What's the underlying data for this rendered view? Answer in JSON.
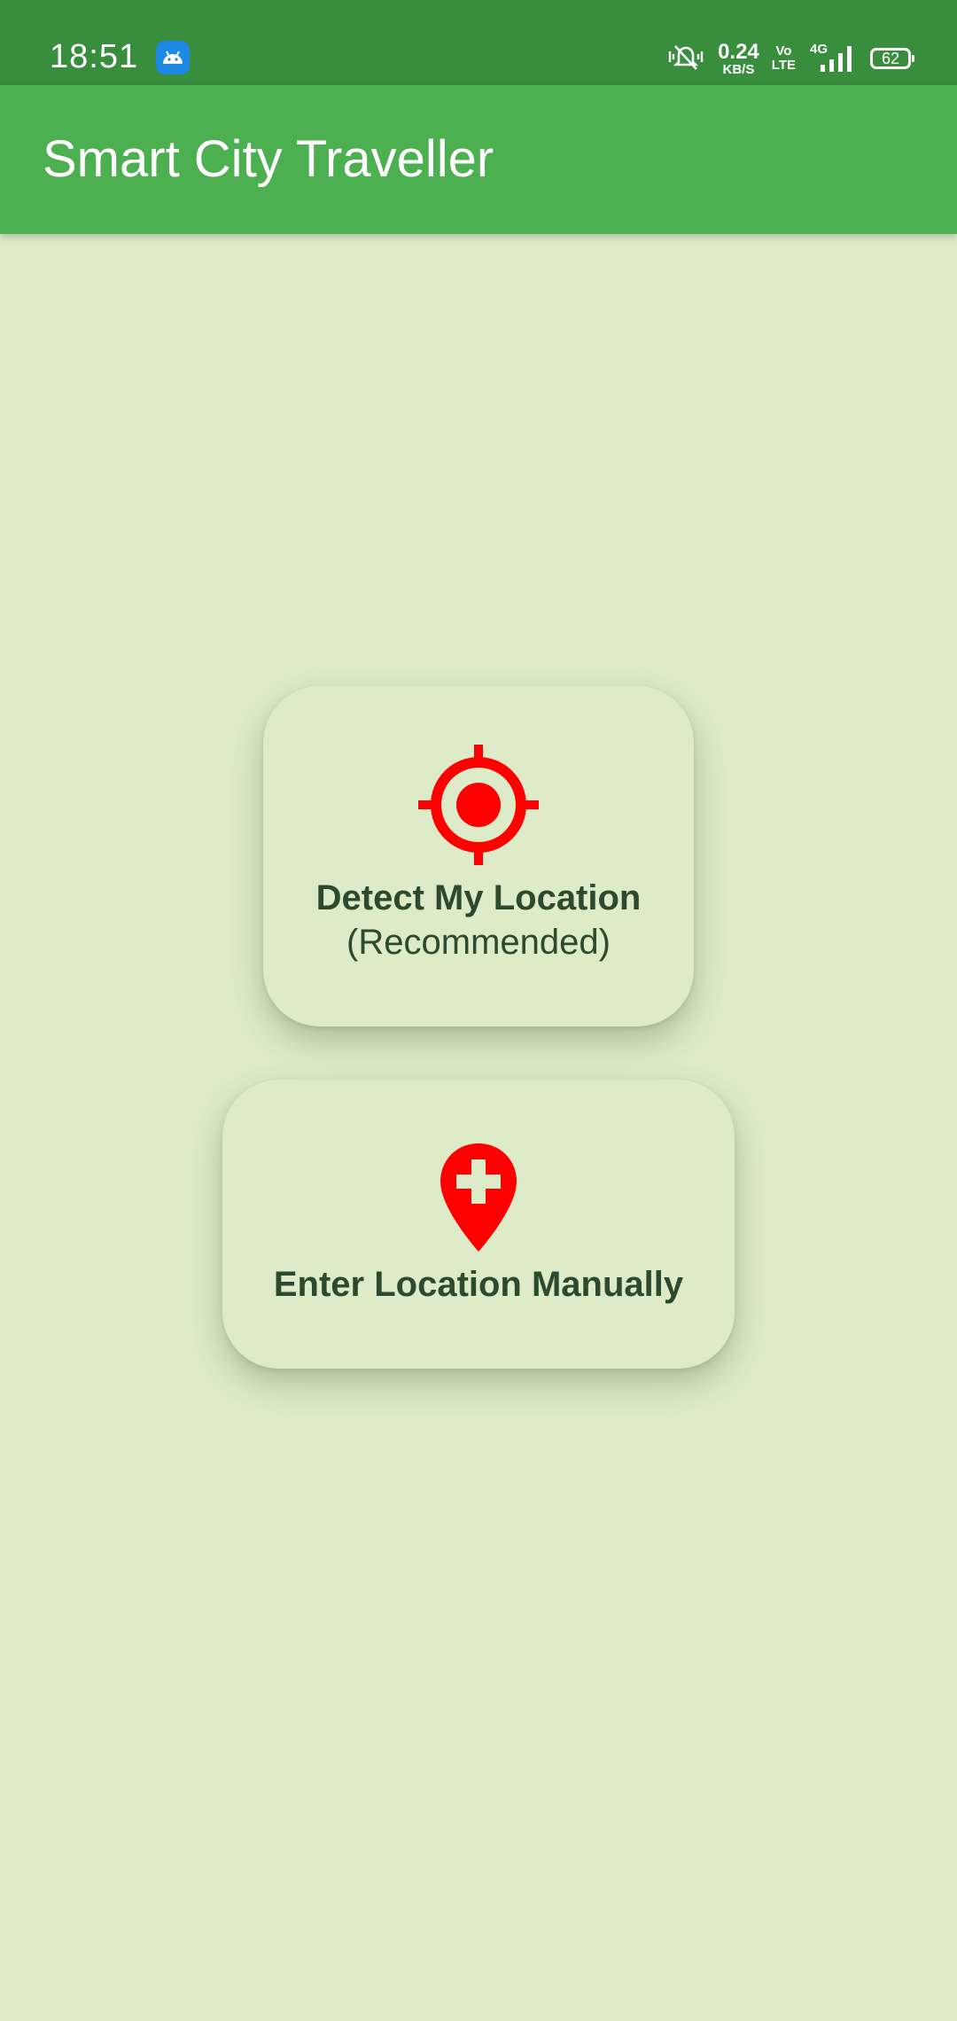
{
  "status_bar": {
    "time": "18:51",
    "speed_value": "0.24",
    "speed_unit": "KB/S",
    "volte_top": "Vo",
    "volte_bottom": "LTE",
    "network": "4G",
    "battery": "62"
  },
  "app_bar": {
    "title": "Smart City Traveller"
  },
  "options": {
    "detect": {
      "label": "Detect My Location",
      "sub": "(Recommended)",
      "icon": "crosshair-icon"
    },
    "manual": {
      "label": "Enter Location Manually",
      "icon": "add-location-pin-icon"
    }
  },
  "colors": {
    "status_bar": "#388E3C",
    "app_bar": "#4CAF50",
    "background": "#DDEBC8",
    "icon_red": "#FF0000",
    "text_dark_green": "#2E4A2E"
  }
}
